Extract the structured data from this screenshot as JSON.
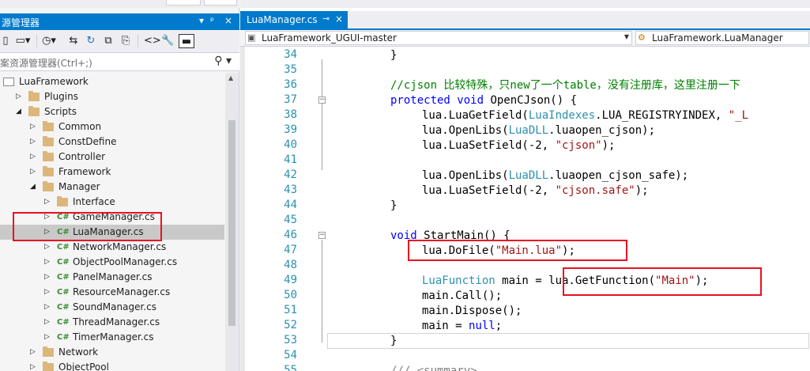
{
  "solution_explorer": {
    "title": "源管理器",
    "search_placeholder": "案资源管理器(Ctrl+;)",
    "pin_glyph": "▾ ᵖ",
    "tree": [
      {
        "label": "LuaFramework",
        "icon": "project",
        "arrow": "",
        "indent": 0
      },
      {
        "label": "Plugins",
        "icon": "folder",
        "arrow": "right",
        "indent": 1
      },
      {
        "label": "Scripts",
        "icon": "folder",
        "arrow": "down",
        "indent": 1
      },
      {
        "label": "Common",
        "icon": "folder",
        "arrow": "right",
        "indent": 2
      },
      {
        "label": "ConstDefine",
        "icon": "folder",
        "arrow": "right",
        "indent": 2
      },
      {
        "label": "Controller",
        "icon": "folder",
        "arrow": "right",
        "indent": 2
      },
      {
        "label": "Framework",
        "icon": "folder",
        "arrow": "right",
        "indent": 2
      },
      {
        "label": "Manager",
        "icon": "folder",
        "arrow": "down",
        "indent": 2
      },
      {
        "label": "Interface",
        "icon": "folder",
        "arrow": "right",
        "indent": 3
      },
      {
        "label": "GameManager.cs",
        "icon": "csharp",
        "arrow": "right",
        "indent": 3
      },
      {
        "label": "LuaManager.cs",
        "icon": "csharp",
        "arrow": "right",
        "indent": 3,
        "selected": true
      },
      {
        "label": "NetworkManager.cs",
        "icon": "csharp",
        "arrow": "right",
        "indent": 3
      },
      {
        "label": "ObjectPoolManager.cs",
        "icon": "csharp",
        "arrow": "right",
        "indent": 3
      },
      {
        "label": "PanelManager.cs",
        "icon": "csharp",
        "arrow": "right",
        "indent": 3
      },
      {
        "label": "ResourceManager.cs",
        "icon": "csharp",
        "arrow": "right",
        "indent": 3
      },
      {
        "label": "SoundManager.cs",
        "icon": "csharp",
        "arrow": "right",
        "indent": 3
      },
      {
        "label": "ThreadManager.cs",
        "icon": "csharp",
        "arrow": "right",
        "indent": 3
      },
      {
        "label": "TimerManager.cs",
        "icon": "csharp",
        "arrow": "right",
        "indent": 3
      },
      {
        "label": "Network",
        "icon": "folder",
        "arrow": "right",
        "indent": 2
      },
      {
        "label": "ObjectPool",
        "icon": "folder",
        "arrow": "right",
        "indent": 2
      }
    ]
  },
  "editor": {
    "tab_label": "LuaManager.cs",
    "tab_pin": "⊸",
    "tab_close": "×",
    "nav_left": "LuaFramework_UGUI-master",
    "nav_right": "LuaFramework.LuaManager",
    "line_numbers": [
      "34",
      "35",
      "36",
      "37",
      "38",
      "39",
      "40",
      "41",
      "42",
      "43",
      "44",
      "45",
      "46",
      "47",
      "48",
      "49",
      "50",
      "51",
      "52",
      "53",
      "54",
      "55"
    ]
  },
  "colors": {
    "accent": "#007acc",
    "keyword": "#0000ff",
    "type": "#2b91af",
    "string": "#a31515",
    "comment": "#008000",
    "highlight_box": "#e81123"
  }
}
